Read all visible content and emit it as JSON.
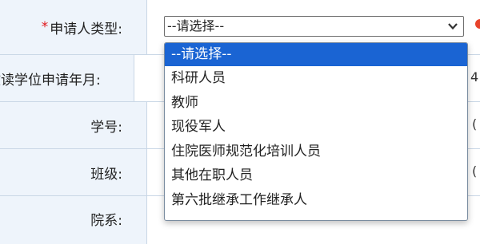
{
  "rows": [
    {
      "required": "*",
      "label": "申请人类型:"
    },
    {
      "label": "攻读学位申请年月:"
    },
    {
      "label": "学号:"
    },
    {
      "label": "班级:"
    },
    {
      "label": "院系:"
    }
  ],
  "select": {
    "value": "--请选择--"
  },
  "edge": {
    "row2": "4",
    "row3": "(",
    "row4": "("
  },
  "options": [
    "--请选择--",
    "科研人员",
    "教师",
    "现役军人",
    "住院医师规范化培训人员",
    "其他在职人员",
    "第六批继承工作继承人"
  ],
  "colors": {
    "accent": "#1a64d3",
    "required": "#e0151a",
    "label_bg": "#eef4fb"
  }
}
